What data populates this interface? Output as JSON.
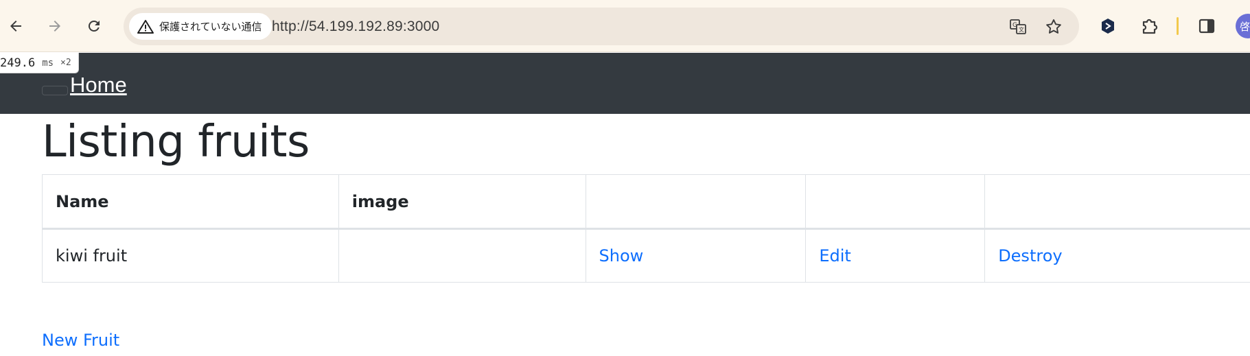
{
  "browser": {
    "security_label": "保護されていない通信",
    "url": "http://54.199.192.89:3000",
    "profile_initial": "啓太"
  },
  "perf_badge": {
    "time": "249.6",
    "unit": "ms",
    "count": "×2"
  },
  "navbar": {
    "brand": "Home"
  },
  "page": {
    "title": "Listing fruits"
  },
  "table": {
    "headers": [
      "Name",
      "image",
      "",
      "",
      ""
    ],
    "rows": [
      {
        "name": "kiwi fruit",
        "image": "",
        "show": "Show",
        "edit": "Edit",
        "destroy": "Destroy"
      }
    ]
  },
  "footer_link": "New Fruit",
  "colors": {
    "navbar_bg": "#343a40",
    "link": "#0d6efd",
    "chrome_bg": "#fcf6ec",
    "omnibox_bg": "#efe7dd"
  }
}
